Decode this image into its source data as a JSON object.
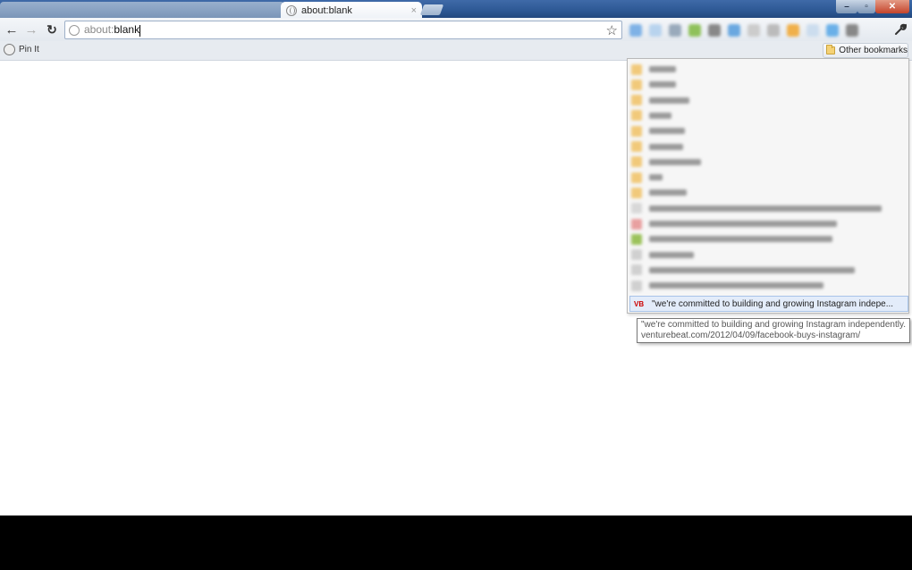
{
  "tabs": [
    {
      "title": "about:blank",
      "close": "×",
      "active": true
    }
  ],
  "window_controls": {
    "minimize": "–",
    "maximize": "▫",
    "close": "✕"
  },
  "toolbar": {
    "back": "←",
    "forward": "→",
    "reload": "↻",
    "address_scheme": "about:",
    "address_host": "blank",
    "star": "☆",
    "wrench": "🔧"
  },
  "bookmarks_bar": {
    "pin_label": "Pin It",
    "other_bookmarks": "Other bookmarks",
    "icon_colors": [
      "#7fb2e6",
      "#b8d3ee",
      "#9ab",
      "#8fc15a",
      "#888",
      "#6aa8e0",
      "#ccc",
      "#bbb",
      "#f0b04a",
      "#cde",
      "#6ab0e8",
      "#888"
    ]
  },
  "dropdown": {
    "highlighted_item": {
      "icon": "VB",
      "label": "\"we're committed to building and growing Instagram indepe..."
    }
  },
  "tooltip": {
    "line1": "\"we're committed to building and growing Instagram independently.\"",
    "line2": "venturebeat.com/2012/04/09/facebook-buys-instagram/"
  },
  "colors": {
    "titlebar": "#2d5894",
    "folder": "#f5d276",
    "highlight": "#e3ecfa"
  }
}
